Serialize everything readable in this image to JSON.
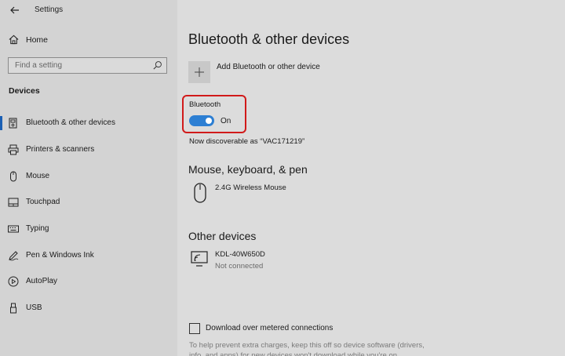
{
  "app": {
    "title": "Settings"
  },
  "sidebar": {
    "home_label": "Home",
    "search_placeholder": "Find a setting",
    "section_label": "Devices",
    "items": [
      {
        "label": "Bluetooth & other devices",
        "icon": "bluetooth-devices-icon",
        "selected": true
      },
      {
        "label": "Printers & scanners",
        "icon": "printer-icon",
        "selected": false
      },
      {
        "label": "Mouse",
        "icon": "mouse-icon",
        "selected": false
      },
      {
        "label": "Touchpad",
        "icon": "touchpad-icon",
        "selected": false
      },
      {
        "label": "Typing",
        "icon": "keyboard-icon",
        "selected": false
      },
      {
        "label": "Pen & Windows Ink",
        "icon": "pen-icon",
        "selected": false
      },
      {
        "label": "AutoPlay",
        "icon": "autoplay-icon",
        "selected": false
      },
      {
        "label": "USB",
        "icon": "usb-icon",
        "selected": false
      }
    ]
  },
  "main": {
    "title": "Bluetooth & other devices",
    "add_device_label": "Add Bluetooth or other device",
    "bluetooth": {
      "label": "Bluetooth",
      "state": "On",
      "discoverable_text": "Now discoverable as “VAC171219”"
    },
    "mouse_section": {
      "heading": "Mouse, keyboard, & pen",
      "devices": [
        {
          "name": "2.4G Wireless Mouse",
          "status": ""
        }
      ]
    },
    "other_section": {
      "heading": "Other devices",
      "devices": [
        {
          "name": "KDL-40W650D",
          "status": "Not connected"
        }
      ]
    },
    "metered": {
      "label": "Download over metered connections",
      "checked": false
    },
    "help_text": "To help prevent extra charges, keep this off so device software (drivers, info, and apps) for new devices won't download while you're on"
  },
  "colors": {
    "accent": "#2d7fd3",
    "highlight_border": "#d11a1a",
    "selected_indicator": "#1a5fb4"
  }
}
